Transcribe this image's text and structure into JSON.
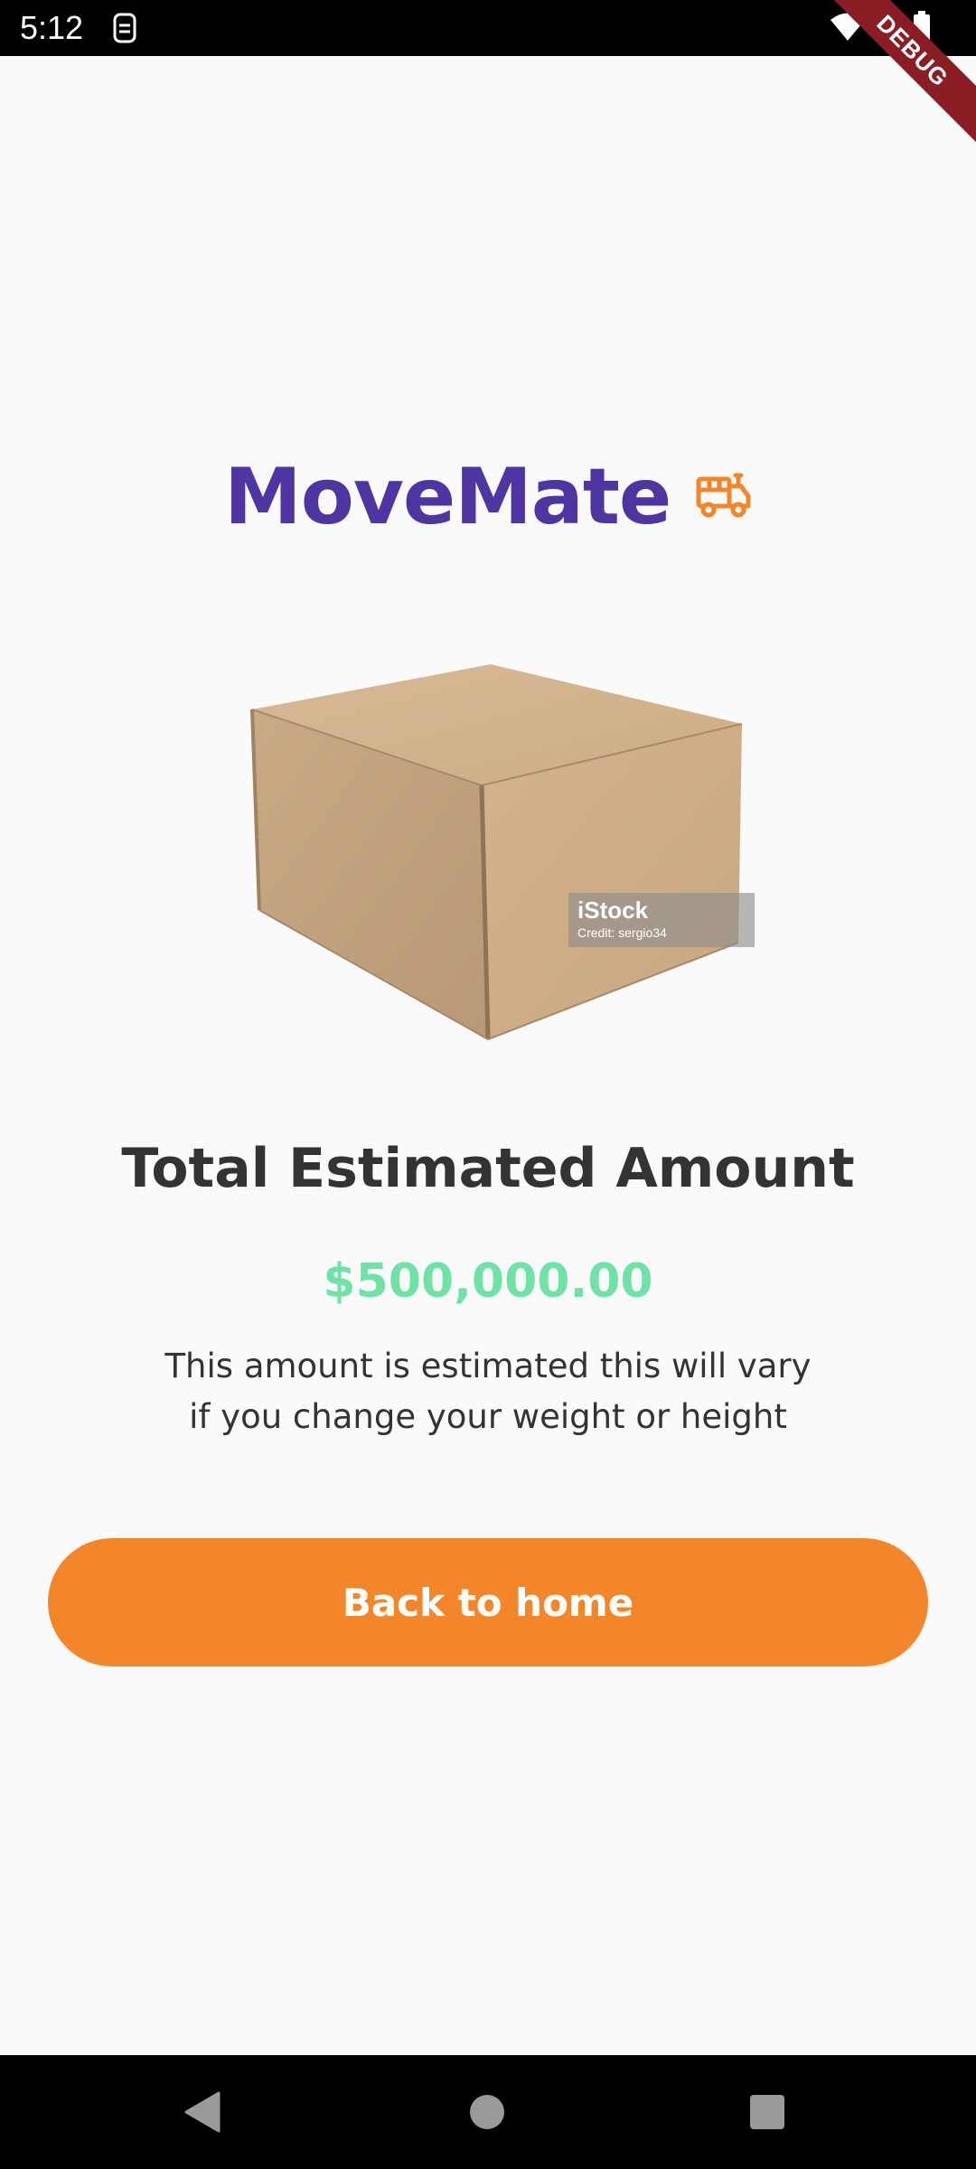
{
  "status_bar": {
    "time": "5:12",
    "debug_label": "DEBUG"
  },
  "brand": {
    "title": "MoveMate",
    "icon": "truck-icon",
    "title_color": "#4e35a1",
    "icon_color": "#f3862a"
  },
  "image": {
    "subject": "cardboard box",
    "watermark_brand": "iStock",
    "watermark_credit": "Credit: sergio34"
  },
  "result": {
    "headline": "Total Estimated Amount",
    "amount": "$500,000.00",
    "amount_color": "#6fe3a6",
    "note_line1": "This amount is estimated this will vary",
    "note_line2": "if you change your weight or height"
  },
  "actions": {
    "back_label": "Back to home",
    "button_color": "#f3862a"
  },
  "nav_bar": {
    "back_icon": "back-triangle-icon",
    "home_icon": "home-circle-icon",
    "recent_icon": "recents-square-icon"
  }
}
